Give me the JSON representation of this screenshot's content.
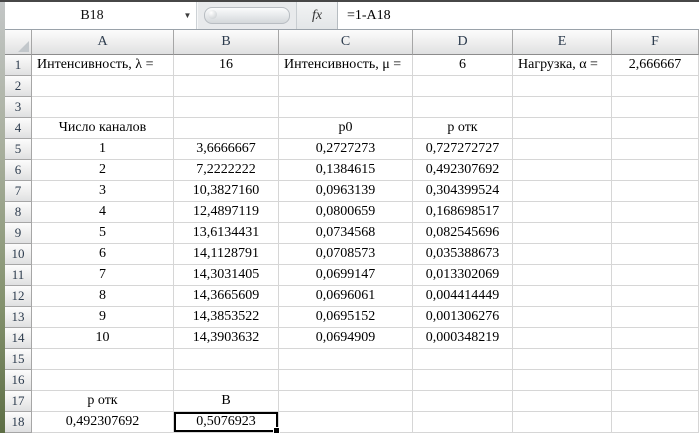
{
  "formula_bar": {
    "cell_reference": "B18",
    "formula": "=1-A18",
    "fx_label": "fx",
    "dropdown_glyph": "▼"
  },
  "colors": {
    "selection_border": "#000000",
    "grid_line": "#d6d6d6",
    "header_text": "#2c3b4d",
    "window_frame_top": "#c3c6c6",
    "window_frame_bottom": "#5d6e45"
  },
  "sheet": {
    "column_headers": [
      "A",
      "B",
      "C",
      "D",
      "E",
      "F"
    ],
    "row_count": 18,
    "selected_cell": {
      "row": 18,
      "col": "B"
    },
    "cells": [
      {
        "r": 1,
        "c": "A",
        "v": "Интенсивность, λ =",
        "align": "left"
      },
      {
        "r": 1,
        "c": "B",
        "v": "16"
      },
      {
        "r": 1,
        "c": "C",
        "v": "Интенсивность, μ =",
        "align": "left"
      },
      {
        "r": 1,
        "c": "D",
        "v": "6"
      },
      {
        "r": 1,
        "c": "E",
        "v": "Нагрузка, α =",
        "align": "left"
      },
      {
        "r": 1,
        "c": "F",
        "v": "2,666667"
      },
      {
        "r": 4,
        "c": "A",
        "v": "Число каналов"
      },
      {
        "r": 4,
        "c": "C",
        "v": "p0"
      },
      {
        "r": 4,
        "c": "D",
        "v": "p отк"
      },
      {
        "r": 5,
        "c": "A",
        "v": "1"
      },
      {
        "r": 5,
        "c": "B",
        "v": "3,6666667"
      },
      {
        "r": 5,
        "c": "C",
        "v": "0,2727273"
      },
      {
        "r": 5,
        "c": "D",
        "v": "0,727272727"
      },
      {
        "r": 6,
        "c": "A",
        "v": "2"
      },
      {
        "r": 6,
        "c": "B",
        "v": "7,2222222"
      },
      {
        "r": 6,
        "c": "C",
        "v": "0,1384615"
      },
      {
        "r": 6,
        "c": "D",
        "v": "0,492307692"
      },
      {
        "r": 7,
        "c": "A",
        "v": "3"
      },
      {
        "r": 7,
        "c": "B",
        "v": "10,3827160"
      },
      {
        "r": 7,
        "c": "C",
        "v": "0,0963139"
      },
      {
        "r": 7,
        "c": "D",
        "v": "0,304399524"
      },
      {
        "r": 8,
        "c": "A",
        "v": "4"
      },
      {
        "r": 8,
        "c": "B",
        "v": "12,4897119"
      },
      {
        "r": 8,
        "c": "C",
        "v": "0,0800659"
      },
      {
        "r": 8,
        "c": "D",
        "v": "0,168698517"
      },
      {
        "r": 9,
        "c": "A",
        "v": "5"
      },
      {
        "r": 9,
        "c": "B",
        "v": "13,6134431"
      },
      {
        "r": 9,
        "c": "C",
        "v": "0,0734568"
      },
      {
        "r": 9,
        "c": "D",
        "v": "0,082545696"
      },
      {
        "r": 10,
        "c": "A",
        "v": "6"
      },
      {
        "r": 10,
        "c": "B",
        "v": "14,1128791"
      },
      {
        "r": 10,
        "c": "C",
        "v": "0,0708573"
      },
      {
        "r": 10,
        "c": "D",
        "v": "0,035388673"
      },
      {
        "r": 11,
        "c": "A",
        "v": "7"
      },
      {
        "r": 11,
        "c": "B",
        "v": "14,3031405"
      },
      {
        "r": 11,
        "c": "C",
        "v": "0,0699147"
      },
      {
        "r": 11,
        "c": "D",
        "v": "0,013302069"
      },
      {
        "r": 12,
        "c": "A",
        "v": "8"
      },
      {
        "r": 12,
        "c": "B",
        "v": "14,3665609"
      },
      {
        "r": 12,
        "c": "C",
        "v": "0,0696061"
      },
      {
        "r": 12,
        "c": "D",
        "v": "0,004414449"
      },
      {
        "r": 13,
        "c": "A",
        "v": "9"
      },
      {
        "r": 13,
        "c": "B",
        "v": "14,3853522"
      },
      {
        "r": 13,
        "c": "C",
        "v": "0,0695152"
      },
      {
        "r": 13,
        "c": "D",
        "v": "0,001306276"
      },
      {
        "r": 14,
        "c": "A",
        "v": "10"
      },
      {
        "r": 14,
        "c": "B",
        "v": "14,3903632"
      },
      {
        "r": 14,
        "c": "C",
        "v": "0,0694909"
      },
      {
        "r": 14,
        "c": "D",
        "v": "0,000348219"
      },
      {
        "r": 17,
        "c": "A",
        "v": "p отк"
      },
      {
        "r": 17,
        "c": "B",
        "v": "B"
      },
      {
        "r": 18,
        "c": "A",
        "v": "0,492307692"
      },
      {
        "r": 18,
        "c": "B",
        "v": "0,5076923"
      }
    ]
  }
}
